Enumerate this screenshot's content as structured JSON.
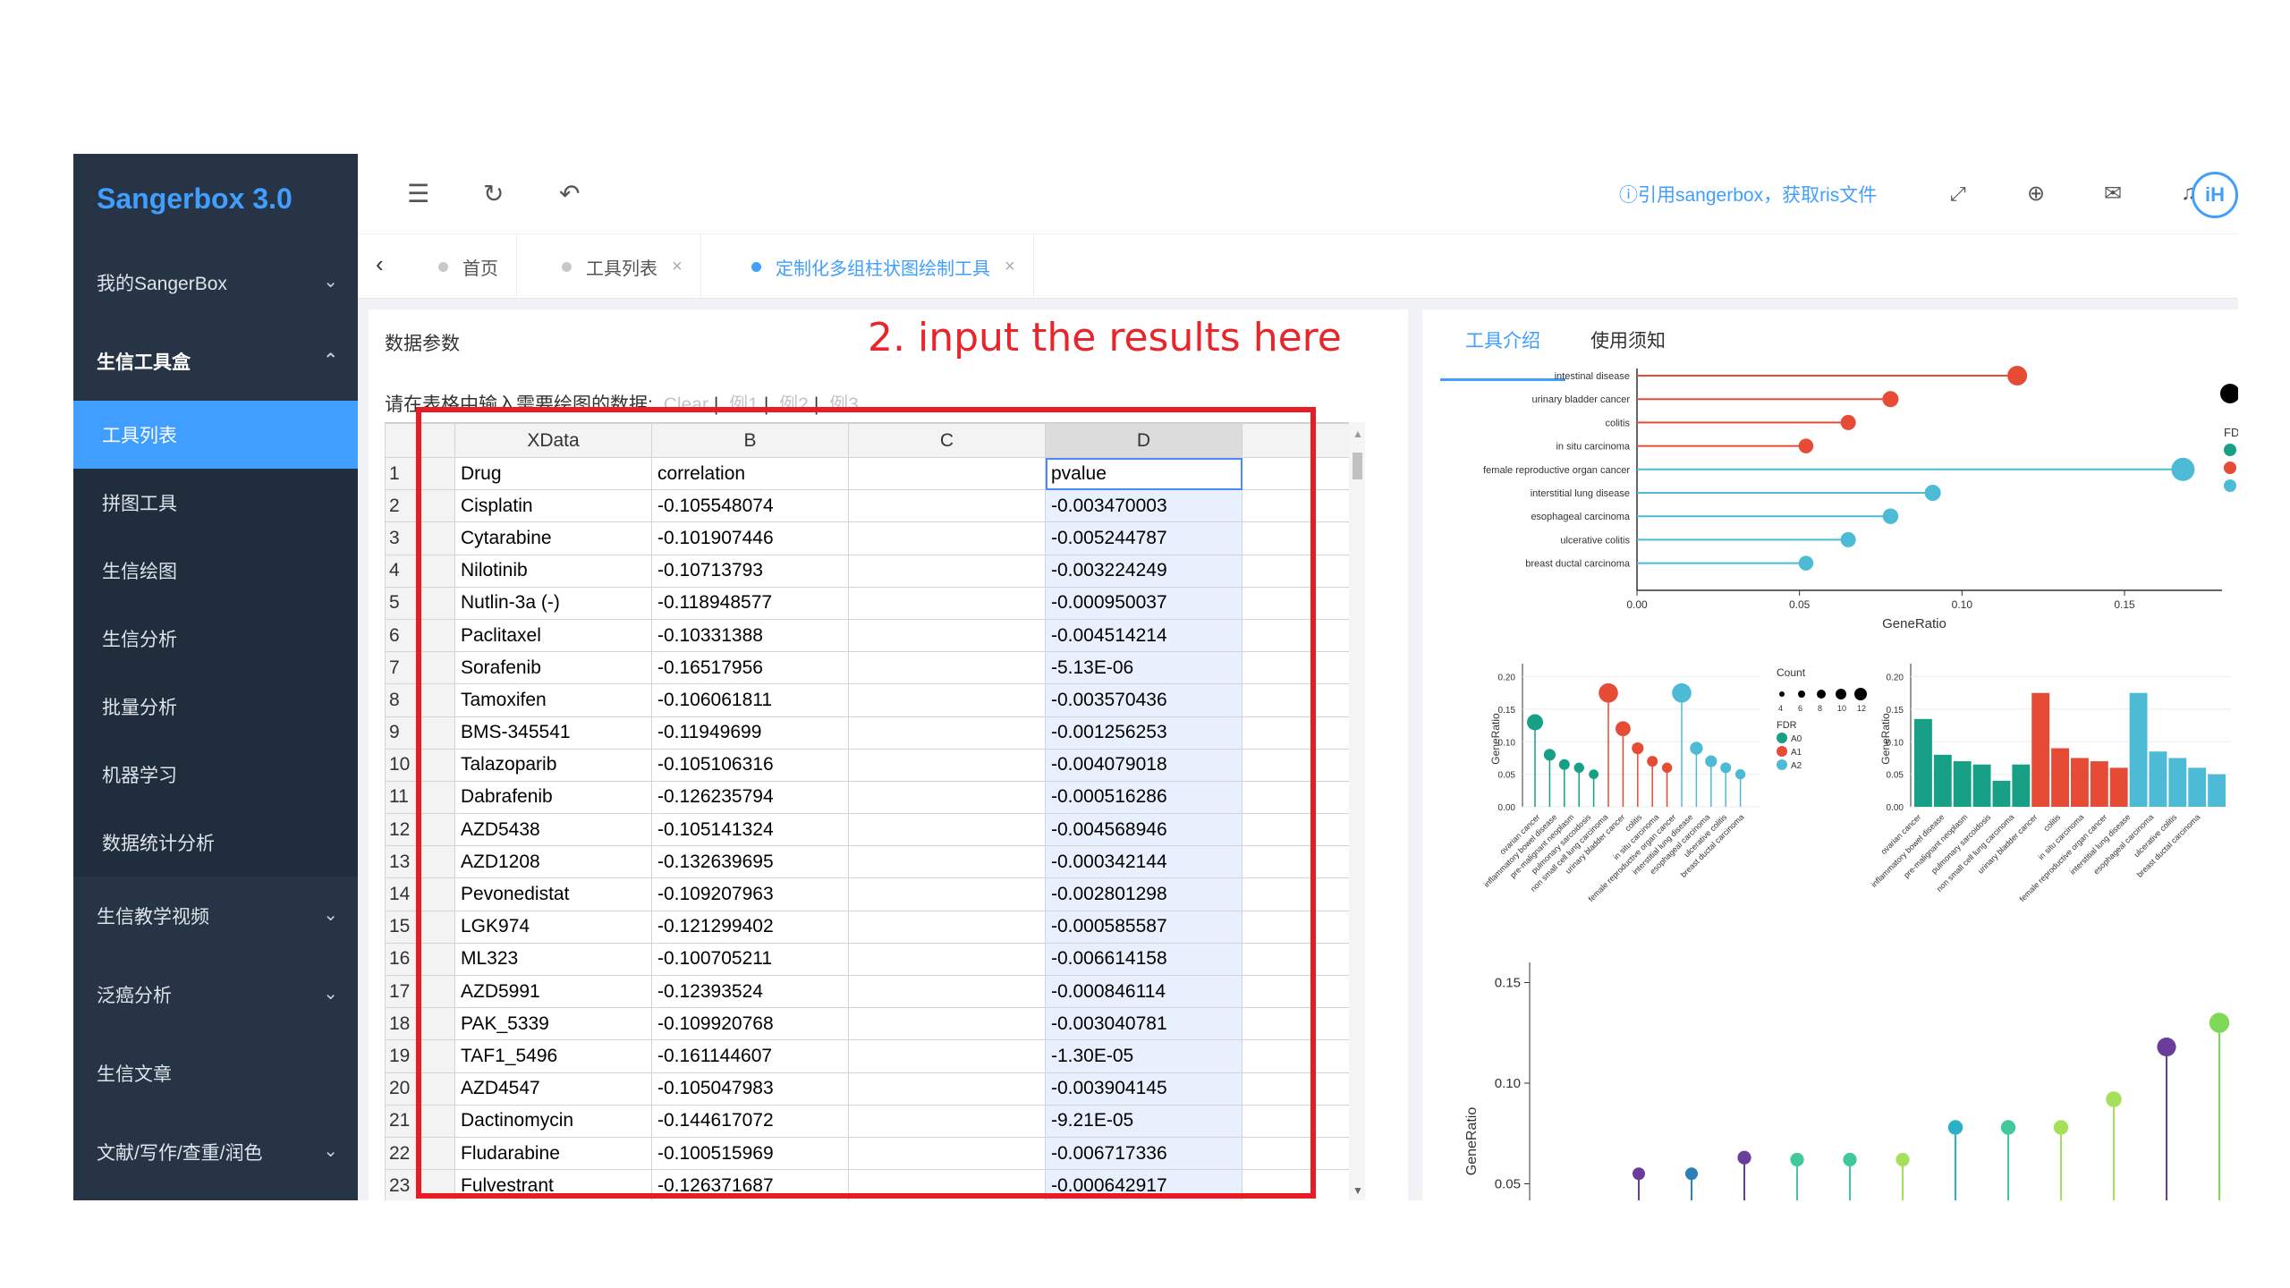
{
  "app": {
    "logo": "Sangerbox 3.0",
    "header": {
      "cite_link": "ⓘ引用sangerbox，获取ris文件",
      "avatar": "iH"
    },
    "sidebar": {
      "groups": [
        {
          "label": "我的SangerBox"
        },
        {
          "label": "生信工具盒"
        },
        {
          "label": "生信教学视频"
        },
        {
          "label": "泛癌分析"
        },
        {
          "label": "生信文章"
        },
        {
          "label": "文献/写作/查重/润色"
        }
      ],
      "sub_items": [
        {
          "label": "工具列表"
        },
        {
          "label": "拼图工具"
        },
        {
          "label": "生信绘图"
        },
        {
          "label": "生信分析"
        },
        {
          "label": "批量分析"
        },
        {
          "label": "机器学习"
        },
        {
          "label": "数据统计分析"
        }
      ]
    },
    "tabs": [
      {
        "label": "首页"
      },
      {
        "label": "工具列表"
      },
      {
        "label": "定制化多组柱状图绘制工具"
      }
    ],
    "left_panel": {
      "title": "数据参数",
      "instruction": "请在表格中输入需要绘图的数据:",
      "examples": [
        "Clear",
        "例1",
        "例2",
        "例3"
      ]
    },
    "right_panel": {
      "tabs": [
        "工具介绍",
        "使用须知"
      ]
    }
  },
  "sheet": {
    "columns": [
      "XData",
      "B",
      "C",
      "D"
    ],
    "rows": [
      [
        "1",
        "Drug",
        "correlation",
        "",
        "pvalue"
      ],
      [
        "2",
        "Cisplatin",
        "-0.105548074",
        "",
        "-0.003470003"
      ],
      [
        "3",
        "Cytarabine",
        "-0.101907446",
        "",
        "-0.005244787"
      ],
      [
        "4",
        "Nilotinib",
        "-0.10713793",
        "",
        "-0.003224249"
      ],
      [
        "5",
        "Nutlin-3a (-)",
        "-0.118948577",
        "",
        "-0.000950037"
      ],
      [
        "6",
        "Paclitaxel",
        "-0.10331388",
        "",
        "-0.004514214"
      ],
      [
        "7",
        "Sorafenib",
        "-0.16517956",
        "",
        "-5.13E-06"
      ],
      [
        "8",
        "Tamoxifen",
        "-0.106061811",
        "",
        "-0.003570436"
      ],
      [
        "9",
        "BMS-345541",
        "-0.11949699",
        "",
        "-0.001256253"
      ],
      [
        "10",
        "Talazoparib",
        "-0.105106316",
        "",
        "-0.004079018"
      ],
      [
        "11",
        "Dabrafenib",
        "-0.126235794",
        "",
        "-0.000516286"
      ],
      [
        "12",
        "AZD5438",
        "-0.105141324",
        "",
        "-0.004568946"
      ],
      [
        "13",
        "AZD1208",
        "-0.132639695",
        "",
        "-0.000342144"
      ],
      [
        "14",
        "Pevonedistat",
        "-0.109207963",
        "",
        "-0.002801298"
      ],
      [
        "15",
        "LGK974",
        "-0.121299402",
        "",
        "-0.000585587"
      ],
      [
        "16",
        "ML323",
        "-0.100705211",
        "",
        "-0.006614158"
      ],
      [
        "17",
        "AZD5991",
        "-0.12393524",
        "",
        "-0.000846114"
      ],
      [
        "18",
        "PAK_5339",
        "-0.109920768",
        "",
        "-0.003040781"
      ],
      [
        "19",
        "TAF1_5496",
        "-0.161144607",
        "",
        "-1.30E-05"
      ],
      [
        "20",
        "AZD4547",
        "-0.105047983",
        "",
        "-0.003904145"
      ],
      [
        "21",
        "Dactinomycin",
        "-0.144617072",
        "",
        "-9.21E-05"
      ],
      [
        "22",
        "Fludarabine",
        "-0.100515969",
        "",
        "-0.006717336"
      ],
      [
        "23",
        "Fulvestrant",
        "-0.126371687",
        "",
        "-0.000642917"
      ]
    ]
  },
  "annotation": "2. input the results here",
  "charts": {
    "chart1": {
      "type": "lollipop",
      "categories": [
        "intestinal disease",
        "urinary bladder cancer",
        "colitis",
        "in situ carcinoma",
        "female reproductive organ cancer",
        "interstitial lung disease",
        "esophageal carcinoma",
        "ulcerative colitis",
        "breast ductal carcinoma"
      ],
      "values": [
        0.117,
        0.078,
        0.065,
        0.052,
        0.168,
        0.091,
        0.078,
        0.065,
        0.052
      ],
      "sizes": [
        1,
        0.6,
        0.5,
        0.45,
        1.4,
        0.6,
        0.55,
        0.5,
        0.45
      ],
      "groups": [
        "A1",
        "A1",
        "A1",
        "A1",
        "A2",
        "A2",
        "A2",
        "A2",
        "A2"
      ],
      "xticks": [
        "0.00",
        "0.05",
        "0.10",
        "0.15"
      ],
      "xlabel": "GeneRatio",
      "xlim": [
        0,
        0.18
      ],
      "legend_title": "FD"
    },
    "chart2": {
      "type": "lollipop-vertical",
      "values": [
        0.13,
        0.08,
        0.065,
        0.06,
        0.05,
        0.175,
        0.12,
        0.09,
        0.07,
        0.06,
        0.175,
        0.09,
        0.07,
        0.06,
        0.05
      ],
      "sizes": [
        1,
        0.6,
        0.5,
        0.45,
        0.4,
        1.3,
        0.9,
        0.6,
        0.5,
        0.45,
        1.3,
        0.7,
        0.6,
        0.5,
        0.45
      ],
      "groups": [
        "A0",
        "A0",
        "A0",
        "A0",
        "A0",
        "A1",
        "A1",
        "A1",
        "A1",
        "A1",
        "A2",
        "A2",
        "A2",
        "A2",
        "A2"
      ],
      "yticks": [
        "0.00",
        "0.05",
        "0.10",
        "0.15",
        "0.20"
      ],
      "ylabel": "GeneRatio",
      "ylim": [
        0,
        0.22
      ],
      "legend": {
        "count_title": "Count",
        "count_ticks": [
          "4",
          "6",
          "8",
          "10",
          "12"
        ],
        "fdr_title": "FDR",
        "fdr_items": [
          "A0",
          "A1",
          "A2"
        ]
      }
    },
    "chart3": {
      "type": "bar",
      "values": [
        0.135,
        0.08,
        0.07,
        0.065,
        0.04,
        0.065,
        0.175,
        0.09,
        0.075,
        0.07,
        0.06,
        0.175,
        0.085,
        0.075,
        0.06,
        0.05
      ],
      "groups": [
        "A0",
        "A0",
        "A0",
        "A0",
        "A0",
        "A0",
        "A1",
        "A1",
        "A1",
        "A1",
        "A1",
        "A2",
        "A2",
        "A2",
        "A2",
        "A2"
      ],
      "yticks": [
        "0.00",
        "0.05",
        "0.10",
        "0.15",
        "0.20"
      ],
      "ylabel": "GeneRatio",
      "ylim": [
        0,
        0.22
      ],
      "xlabels": [
        "ovarian cancer",
        "inflammatory bowel disease",
        "pre-malignant neoplasm",
        "pulmonary sarcoidosis",
        "non small cell lung carcinoma",
        "urinary bladder cancer",
        "colitis",
        "in situ carcinoma",
        "female reproductive organ cancer",
        "interstitial lung disease",
        "esophageal carcinoma",
        "ulcerative colitis",
        "breast ductal carcinoma"
      ]
    },
    "chart4": {
      "type": "lollipop",
      "values": [
        0.055,
        0.055,
        0.063,
        0.062,
        0.062,
        0.062,
        0.078,
        0.078,
        0.078,
        0.092,
        0.118,
        0.13
      ],
      "colors": [
        "#6a3d9a",
        "#2c7fb8",
        "#6a3d9a",
        "#41c99a",
        "#41c99a",
        "#a6e05a",
        "#2ab0c8",
        "#41c99a",
        "#a6e05a",
        "#a6e05a",
        "#6a3d9a",
        "#7ed957"
      ],
      "sizes": [
        0.5,
        0.5,
        0.6,
        0.6,
        0.6,
        0.6,
        0.7,
        0.7,
        0.7,
        0.8,
        1.1,
        1.2
      ],
      "yticks": [
        "0.05",
        "0.10",
        "0.15"
      ],
      "ylabel": "GeneRatio",
      "ylim": [
        0.04,
        0.16
      ]
    },
    "colors": {
      "A0": "#17a085",
      "A1": "#e64b35",
      "A2": "#4dbbd5"
    },
    "ch3_colors": {
      "A0": "#17a085",
      "A1": "#e64b35",
      "A2": "#4dbbd5"
    }
  }
}
